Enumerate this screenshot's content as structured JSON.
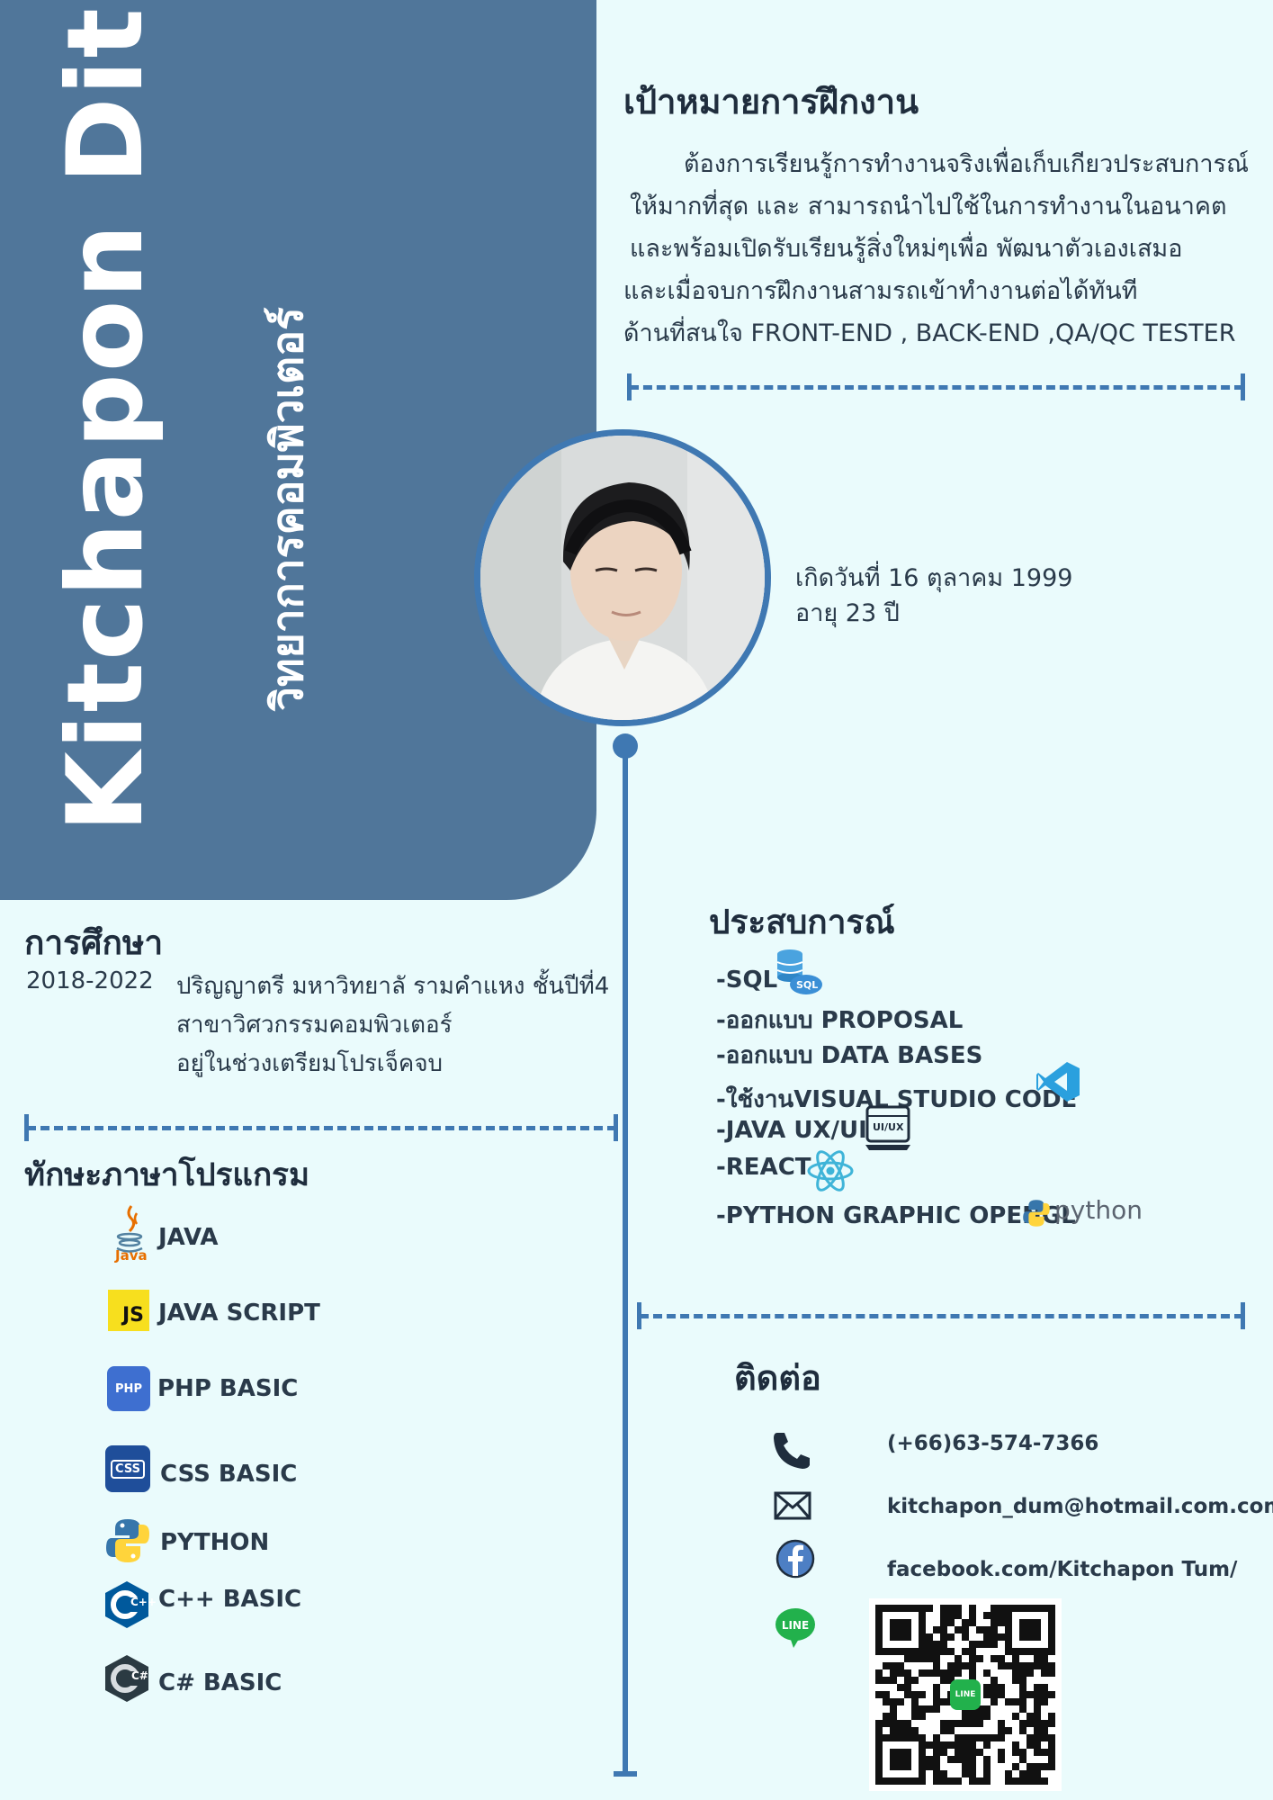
{
  "header": {
    "name": "Kitchapon  Ditpin",
    "faculty": "วิทยาการคอมพิวเตอร์"
  },
  "objective": {
    "title": "เป้าหมายการฝึกงาน",
    "lines": [
      "ต้องการเรียนรู้การทำงานจริงเพื่อเก็บเกียวประสบการณ์",
      "ให้มากที่สุด และ สามารถนำไปใช้ในการทำงานในอนาคต",
      "และพร้อมเปิดรับเรียนรู้สิ่งใหม่ๆเพื่อ  พัฒนาตัวเองเสมอ",
      "และเมื่อจบการฝึกงานสามรถเข้าทำงานต่อได้ทันที",
      "ด้านที่สนใจ FRONT-END  , BACK-END ,QA/QC TESTER"
    ]
  },
  "profile": {
    "birth": "เกิดวันที่ 16 ตุลาคม 1999",
    "age": "อายุ 23 ปี"
  },
  "education": {
    "title": "การศึกษา",
    "years": "2018-2022",
    "lines": [
      "ปริญญาตรี มหาวิทยาลั รามคำแหง ชั้นปีที่4",
      "สาขาวิศวกรรมคอมพิวเตอร์",
      "อยู่ในช่วงเตรียมโปรเจ็คจบ"
    ]
  },
  "skills": {
    "title": "ทักษะภาษาโปรแกรม",
    "items": [
      {
        "label": "JAVA",
        "icon": "java-icon"
      },
      {
        "label": "JAVA SCRIPT",
        "icon": "javascript-icon"
      },
      {
        "label": "PHP BASIC",
        "icon": "php-icon"
      },
      {
        "label": "CSS BASIC",
        "icon": "css-icon"
      },
      {
        "label": "PYTHON",
        "icon": "python-icon"
      },
      {
        "label": "C++ BASIC",
        "icon": "cpp-icon"
      },
      {
        "label": "C# BASIC",
        "icon": "csharp-icon"
      }
    ],
    "java_caption": "Java",
    "js_badge": "JS",
    "php_badge": "PHP",
    "css_badge": "CSS",
    "cpp_badge": "C++",
    "cs_badge": "C#"
  },
  "experience": {
    "title": "ประสบการณ์",
    "items": [
      "-SQL",
      "-ออกแบบ PROPOSAL",
      "-ออกแบบ DATA BASES",
      "-ใช้งานVISUAL STUDIO CODE",
      "-JAVA UX/UI",
      "-REACT",
      "-PYTHON GRAPHIC OPENGL"
    ],
    "sql_badge": "SQL",
    "uiux_badge": "UI/UX",
    "python_word": "python"
  },
  "contact": {
    "title": "ติดต่อ",
    "phone": "(+66)63-574-7366",
    "email": "kitchapon_dum@hotmail.com.com",
    "facebook": "facebook.com/Kitchapon Tum/",
    "line_badge": "LINE",
    "qr_badge": "LINE"
  },
  "colors": {
    "panel": "#50769a",
    "accent": "#3f78b2",
    "background": "#eafbfc"
  }
}
